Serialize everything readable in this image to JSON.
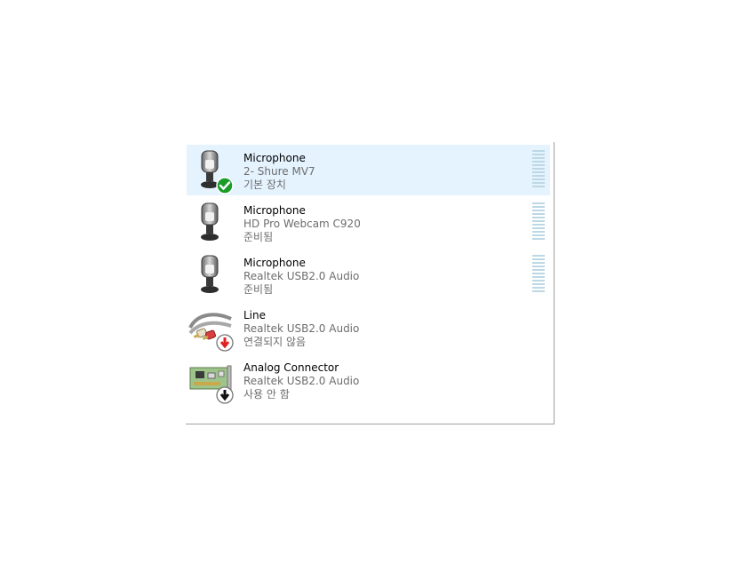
{
  "devices": [
    {
      "name": "Microphone",
      "description": "2- Shure MV7",
      "status": "기본 장치",
      "icon": "microphone-icon",
      "badge": "default-check-badge",
      "selected": true,
      "has_meter": true,
      "level": 0
    },
    {
      "name": "Microphone",
      "description": "HD Pro Webcam C920",
      "status": "준비됨",
      "icon": "microphone-icon",
      "badge": "none",
      "selected": false,
      "has_meter": true,
      "level": 0
    },
    {
      "name": "Microphone",
      "description": "Realtek USB2.0 Audio",
      "status": "준비됨",
      "icon": "microphone-icon",
      "badge": "none",
      "selected": false,
      "has_meter": true,
      "level": 0
    },
    {
      "name": "Line",
      "description": "Realtek USB2.0 Audio",
      "status": "연결되지 않음",
      "icon": "line-in-cable-icon",
      "badge": "not-connected-red-arrow-badge",
      "selected": false,
      "has_meter": false
    },
    {
      "name": "Analog Connector",
      "description": "Realtek USB2.0 Audio",
      "status": "사용 안 함",
      "icon": "sound-card-icon",
      "badge": "disabled-black-arrow-badge",
      "selected": false,
      "has_meter": false
    }
  ],
  "colors": {
    "selected_bg": "#e5f3ff",
    "meter_segment": "#bcd8e4",
    "secondary_text": "#6d6d6d",
    "check_badge": "#1a9c2a",
    "not_connected_arrow": "#e02020"
  }
}
